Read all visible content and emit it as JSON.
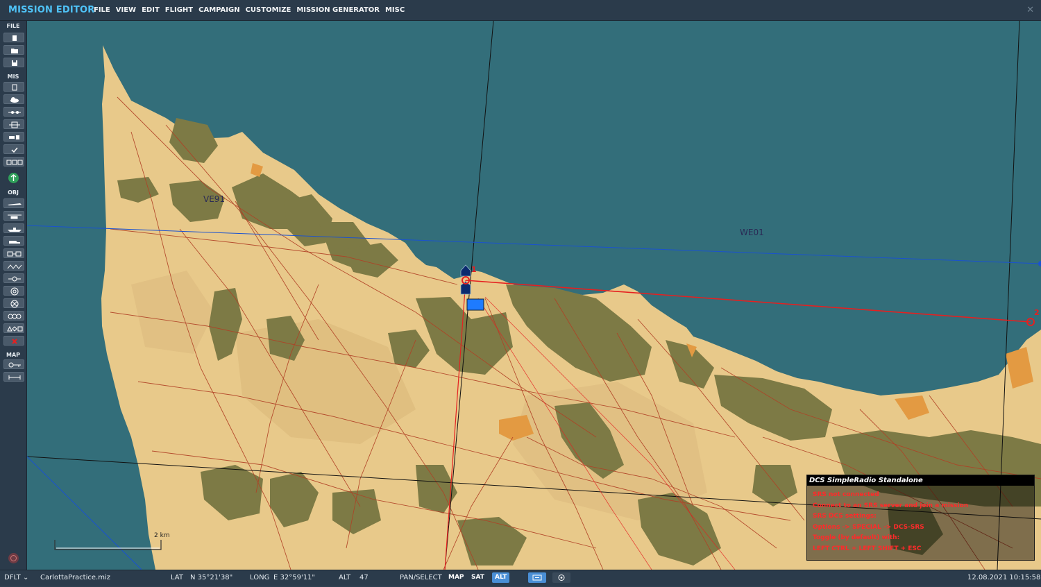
{
  "app": {
    "title": "MISSION EDITOR",
    "menu": [
      "FILE",
      "VIEW",
      "EDIT",
      "FLIGHT",
      "CAMPAIGN",
      "CUSTOMIZE",
      "MISSION GENERATOR",
      "MISC"
    ],
    "close_glyph": "✕"
  },
  "toolbar": {
    "file_label": "FILE",
    "mis_label": "MIS",
    "obj_label": "OBJ",
    "map_label": "MAP",
    "file_buttons": [
      "new-file-icon",
      "open-file-icon",
      "save-file-icon"
    ],
    "mis_buttons": [
      "briefing-icon",
      "weather-icon",
      "triggered-actions-icon",
      "trigger-zone-icon",
      "goals-icon",
      "check-icon",
      "resources-icon"
    ],
    "obj_buttons": [
      "plane-icon",
      "helicopter-icon",
      "ship-icon",
      "vehicle-icon",
      "static-object-icon",
      "map-objects-icon",
      "nav-point-icon",
      "target-icon",
      "destroy-icon",
      "group-icon",
      "shapes-icon",
      "delete-icon"
    ],
    "map_buttons": [
      "ruler-key-icon",
      "measure-icon"
    ]
  },
  "map": {
    "grid_labels": [
      "VE91",
      "WE01"
    ],
    "scale_label": "2 km",
    "waypoint_labels": [
      "1",
      "2"
    ],
    "colors": {
      "sea": "#336e7a",
      "land": "#e8c98a",
      "forest": "#7d7a45",
      "roads": "#b04025",
      "route": "#e52020",
      "grid": "#111111",
      "gridline_blue": "#1a52d0"
    }
  },
  "srs": {
    "title": "DCS SimpleRadio Standalone",
    "lines": [
      "SRS not connected",
      "Connect to an SRS server and join a mission",
      "SRS DCS settings:",
      "Options -> SPECIAL -> DCS-SRS",
      "Toggle (by default) with:",
      "LEFT CTRL + LEFT SHIFT + ESC"
    ]
  },
  "status": {
    "profile": "DFLT",
    "filename": "CarlottaPractice.miz",
    "lat_label": "LAT",
    "lat_value": "N 35°21'38\"",
    "long_label": "LONG",
    "long_value": "E 32°59'11\"",
    "alt_label": "ALT",
    "alt_value": "47",
    "mode": "PAN/SELECT",
    "map_btn": "MAP",
    "sat_btn": "SAT",
    "alt_btn": "ALT",
    "datetime": "12.08.2021 10:15:58"
  }
}
